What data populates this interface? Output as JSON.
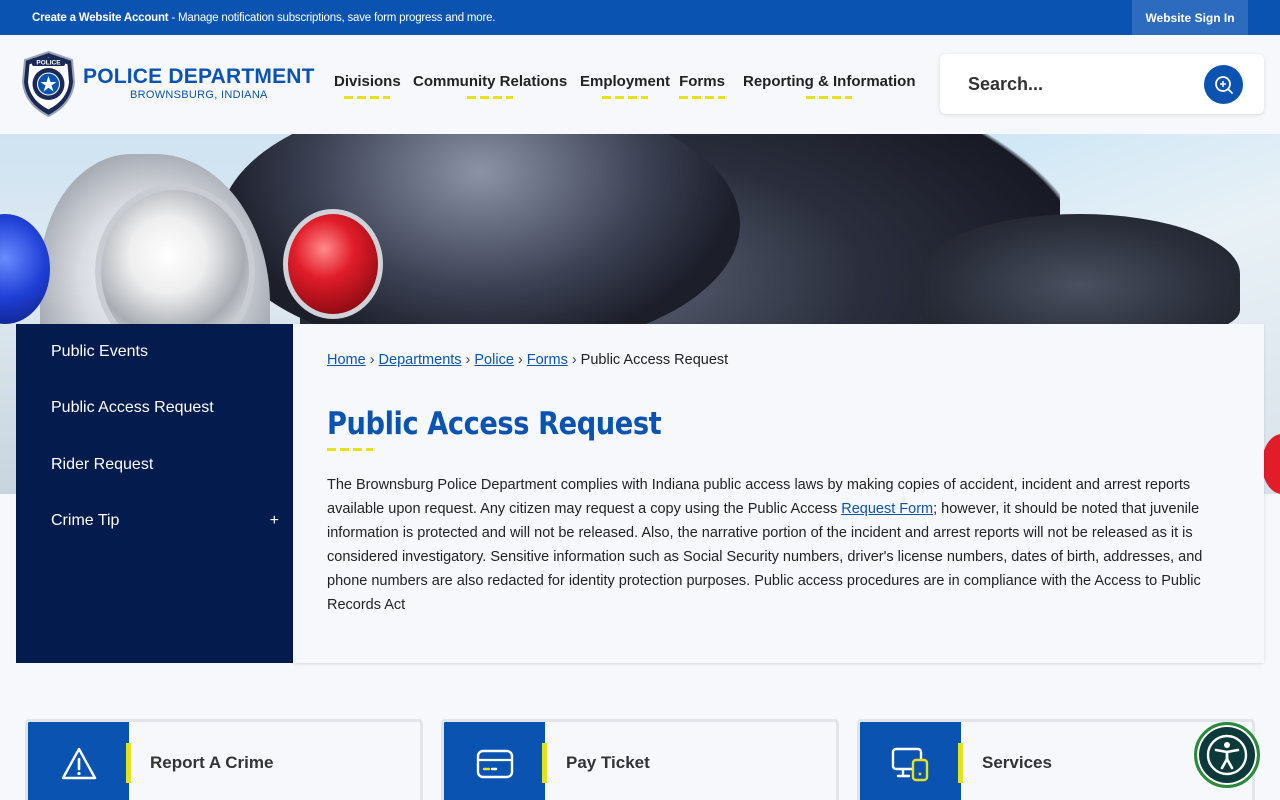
{
  "topbar": {
    "account_bold": "Create a Website Account",
    "account_text": " - Manage notification subscriptions, save form progress and more.",
    "signin": "Website Sign In"
  },
  "logo": {
    "title": "POLICE DEPARTMENT",
    "subtitle": "BROWNSBURG, INDIANA",
    "badge_icon": "police-badge-icon",
    "badge_text": "POLICE"
  },
  "nav": {
    "items": [
      {
        "label": "Divisions"
      },
      {
        "label": "Community Relations"
      },
      {
        "label": "Employment"
      },
      {
        "label": "Forms"
      },
      {
        "label": "Reporting & Information"
      }
    ]
  },
  "search": {
    "placeholder": "Search...",
    "icon": "search-icon"
  },
  "sidebar": {
    "items": [
      {
        "label": "Public Events"
      },
      {
        "label": "Public Access Request"
      },
      {
        "label": "Rider Request"
      },
      {
        "label": "Crime Tip",
        "expand": "+"
      }
    ]
  },
  "breadcrumb": {
    "items": [
      "Home",
      "Departments",
      "Police",
      "Forms"
    ],
    "current": "Public Access Request",
    "separator": "›"
  },
  "page": {
    "title": "Public Access Request",
    "text_part1": "The Brownsburg Police Department complies with Indiana public access laws by making copies of accident, incident and arrest reports available upon request. Any citizen may request a copy using the Public Access ",
    "link": "Request Form",
    "text_part2": "; however, it should be noted that juvenile information is protected and will not be released. Also, the narrative portion of the incident and arrest reports will not be released as it is considered investigatory. Sensitive information such as Social Security numbers, driver's license numbers, dates of birth, addresses, and phone numbers are also redacted for identity protection purposes. Public access procedures are in compliance with the Access to Public Records Act"
  },
  "quicklinks": [
    {
      "label": "Report A Crime",
      "icon": "warning-icon"
    },
    {
      "label": "Pay Ticket",
      "icon": "payment-card-icon"
    },
    {
      "label": "Services",
      "icon": "devices-icon"
    }
  ],
  "accessibility": {
    "icon": "accessibility-icon"
  },
  "colors": {
    "brand_blue": "#0b53b0",
    "navy": "#031c4d",
    "accent_yellow": "#e6e21b"
  }
}
